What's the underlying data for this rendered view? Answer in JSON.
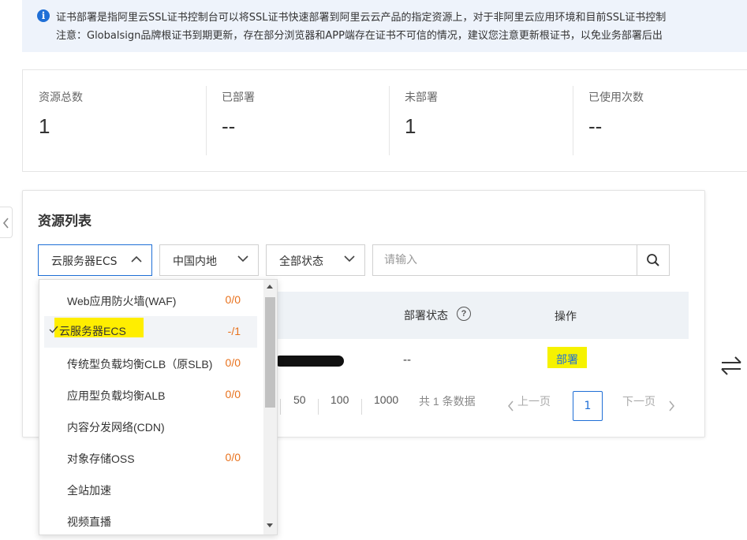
{
  "notice": {
    "icon": "info-icon",
    "line1": "证书部署是指阿里云SSL证书控制台可以将SSL证书快速部署到阿里云云产品的指定资源上，对于非阿里云应用环境和目前SSL证书控制",
    "line2": "注意：Globalsign品牌根证书到期更新，存在部分浏览器和APP端存在证书不可信的情况，建议您注意更新根证书，以免业务部署后出"
  },
  "stats": [
    {
      "label": "资源总数",
      "value": "1"
    },
    {
      "label": "已部署",
      "value": "--"
    },
    {
      "label": "未部署",
      "value": "1"
    },
    {
      "label": "已使用次数",
      "value": "--"
    }
  ],
  "resource_list": {
    "title": "资源列表",
    "filters": {
      "product": "云服务器ECS",
      "region": "中国内地",
      "status": "全部状态"
    },
    "search": {
      "placeholder": "请输入",
      "value": ""
    },
    "columns": {
      "deploy_status": "部署状态",
      "actions": "操作"
    },
    "row": {
      "deploy_status": "--",
      "action": "部署"
    },
    "pagination": {
      "page_sizes": [
        "50",
        "100",
        "1000"
      ],
      "total": "共 1 条数据",
      "prev": "上一页",
      "current": "1",
      "next": "下一页"
    }
  },
  "dropdown": {
    "items": [
      {
        "label": "Web应用防火墙(WAF)",
        "count": "0/0",
        "selected": false
      },
      {
        "label": "云服务器ECS",
        "count": "-/1",
        "selected": true
      },
      {
        "label": "传统型负载均衡CLB（原SLB)",
        "count": "0/0",
        "selected": false
      },
      {
        "label": "应用型负载均衡ALB",
        "count": "0/0",
        "selected": false
      },
      {
        "label": "内容分发网络(CDN)",
        "count": "",
        "selected": false
      },
      {
        "label": "对象存储OSS",
        "count": "0/0",
        "selected": false
      },
      {
        "label": "全站加速",
        "count": "",
        "selected": false
      },
      {
        "label": "视频直播",
        "count": "",
        "selected": false
      }
    ]
  },
  "colors": {
    "accent": "#1f6fd6",
    "count": "#e8711c",
    "highlight": "#ffee00"
  }
}
